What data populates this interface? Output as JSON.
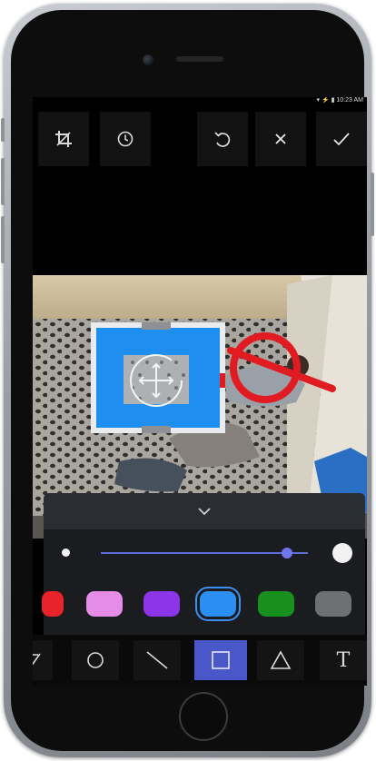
{
  "status_bar": {
    "text": "▾  ⚡ ▮ 10:23 AM"
  },
  "toolbar": {
    "items": [
      {
        "name": "crop-icon"
      },
      {
        "name": "history-icon"
      },
      {
        "name": "undo-icon"
      },
      {
        "name": "close-icon"
      },
      {
        "name": "check-icon"
      }
    ]
  },
  "drawing_panel": {
    "toggle_icon": "chevron-down-icon",
    "stroke_width": {
      "value": 0.9
    },
    "colors": [
      {
        "name": "red",
        "hex": "#e8242a"
      },
      {
        "name": "pink",
        "hex": "#e78be8"
      },
      {
        "name": "purple",
        "hex": "#8b35e6"
      },
      {
        "name": "blue",
        "hex": "#2a8ff0",
        "selected": true
      },
      {
        "name": "green",
        "hex": "#18901e"
      },
      {
        "name": "gray",
        "hex": "#6f7072"
      }
    ]
  },
  "shapes": {
    "items": [
      {
        "name": "arrow-icon"
      },
      {
        "name": "circle-icon"
      },
      {
        "name": "line-icon"
      },
      {
        "name": "square-icon",
        "active": true
      },
      {
        "name": "triangle-icon"
      },
      {
        "name": "text-icon"
      }
    ],
    "text_tool_label": "T"
  }
}
